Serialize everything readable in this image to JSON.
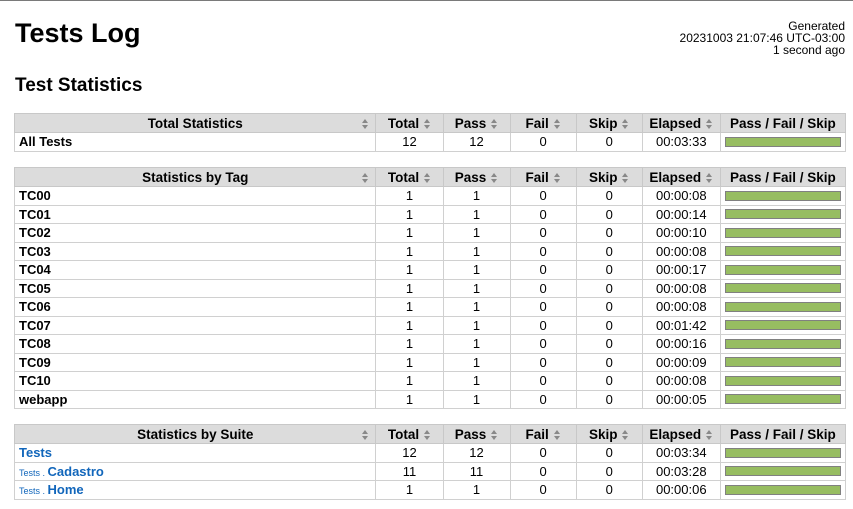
{
  "header": {
    "title": "Tests Log",
    "generated_label": "Generated",
    "generated_timestamp": "20231003 21:07:46 UTC-03:00",
    "generated_ago": "1 second ago"
  },
  "section_title": "Test Statistics",
  "columns": [
    "Total",
    "Pass",
    "Fail",
    "Skip",
    "Elapsed",
    "Pass / Fail / Skip"
  ],
  "total_statistics": {
    "header": "Total Statistics",
    "rows": [
      {
        "name": "All Tests",
        "total": "12",
        "pass": "12",
        "fail": "0",
        "skip": "0",
        "elapsed": "00:03:33",
        "pass_ratio": 1.0
      }
    ]
  },
  "tag_statistics": {
    "header": "Statistics by Tag",
    "rows": [
      {
        "name": "TC00",
        "total": "1",
        "pass": "1",
        "fail": "0",
        "skip": "0",
        "elapsed": "00:00:08",
        "pass_ratio": 1.0
      },
      {
        "name": "TC01",
        "total": "1",
        "pass": "1",
        "fail": "0",
        "skip": "0",
        "elapsed": "00:00:14",
        "pass_ratio": 1.0
      },
      {
        "name": "TC02",
        "total": "1",
        "pass": "1",
        "fail": "0",
        "skip": "0",
        "elapsed": "00:00:10",
        "pass_ratio": 1.0
      },
      {
        "name": "TC03",
        "total": "1",
        "pass": "1",
        "fail": "0",
        "skip": "0",
        "elapsed": "00:00:08",
        "pass_ratio": 1.0
      },
      {
        "name": "TC04",
        "total": "1",
        "pass": "1",
        "fail": "0",
        "skip": "0",
        "elapsed": "00:00:17",
        "pass_ratio": 1.0
      },
      {
        "name": "TC05",
        "total": "1",
        "pass": "1",
        "fail": "0",
        "skip": "0",
        "elapsed": "00:00:08",
        "pass_ratio": 1.0
      },
      {
        "name": "TC06",
        "total": "1",
        "pass": "1",
        "fail": "0",
        "skip": "0",
        "elapsed": "00:00:08",
        "pass_ratio": 1.0
      },
      {
        "name": "TC07",
        "total": "1",
        "pass": "1",
        "fail": "0",
        "skip": "0",
        "elapsed": "00:01:42",
        "pass_ratio": 1.0
      },
      {
        "name": "TC08",
        "total": "1",
        "pass": "1",
        "fail": "0",
        "skip": "0",
        "elapsed": "00:00:16",
        "pass_ratio": 1.0
      },
      {
        "name": "TC09",
        "total": "1",
        "pass": "1",
        "fail": "0",
        "skip": "0",
        "elapsed": "00:00:09",
        "pass_ratio": 1.0
      },
      {
        "name": "TC10",
        "total": "1",
        "pass": "1",
        "fail": "0",
        "skip": "0",
        "elapsed": "00:00:08",
        "pass_ratio": 1.0
      },
      {
        "name": "webapp",
        "total": "1",
        "pass": "1",
        "fail": "0",
        "skip": "0",
        "elapsed": "00:00:05",
        "pass_ratio": 1.0
      }
    ]
  },
  "suite_statistics": {
    "header": "Statistics by Suite",
    "rows": [
      {
        "parent": "",
        "name": "Tests",
        "total": "12",
        "pass": "12",
        "fail": "0",
        "skip": "0",
        "elapsed": "00:03:34",
        "pass_ratio": 1.0
      },
      {
        "parent": "Tests . ",
        "name": "Cadastro",
        "total": "11",
        "pass": "11",
        "fail": "0",
        "skip": "0",
        "elapsed": "00:03:28",
        "pass_ratio": 1.0
      },
      {
        "parent": "Tests . ",
        "name": "Home",
        "total": "1",
        "pass": "1",
        "fail": "0",
        "skip": "0",
        "elapsed": "00:00:06",
        "pass_ratio": 1.0
      }
    ]
  },
  "colors": {
    "pass_bar": "#97bd61",
    "link": "#1166bb",
    "header_bg": "#dcdcdc"
  },
  "icons": {
    "sort": "sort-arrows-icon"
  }
}
